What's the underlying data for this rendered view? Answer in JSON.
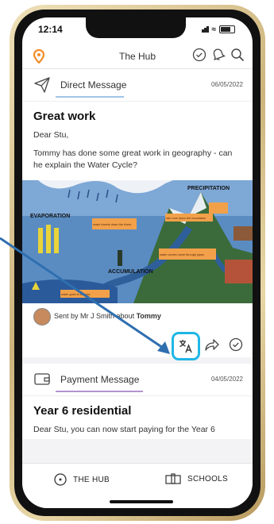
{
  "status_bar": {
    "time": "12:14"
  },
  "app_bar": {
    "title": "The Hub"
  },
  "cards": [
    {
      "type": "Direct Message",
      "date": "06/05/2022",
      "subject": "Great work",
      "greeting": "Dear Stu,",
      "body": "Tommy has done some great work in geography - can he explain the Water Cycle?",
      "picture_labels": {
        "precipitation": "PRECIPITATION",
        "evaporation": "EVAPORATION",
        "accumulation": "ACCUMULATION",
        "note1": "rain runs down the mountains",
        "note2": "water travels down the rivers",
        "note3": "water comes home through pipes",
        "note4": "water goes to the sea"
      },
      "sent_by_prefix": "Sent by ",
      "sender": "Mr J Smith",
      "sent_by_mid": " about ",
      "about": "Tommy"
    },
    {
      "type": "Payment Message",
      "date": "04/05/2022",
      "subject": "Year 6 residential",
      "body": "Dear Stu, you can now start paying for the Year 6"
    }
  ],
  "bottom_nav": {
    "hub": "THE HUB",
    "schools": "SCHOOLS"
  },
  "colors": {
    "accent": "#1fb6e6",
    "logo": "#f28c28",
    "arrow": "#2f6fb0"
  },
  "icons": [
    "location-pin-icon",
    "check-circle-icon",
    "bell-icon",
    "search-icon",
    "paper-plane-icon",
    "translate-icon",
    "share-icon",
    "wallet-icon",
    "signal-icon",
    "wifi-icon",
    "battery-icon"
  ]
}
